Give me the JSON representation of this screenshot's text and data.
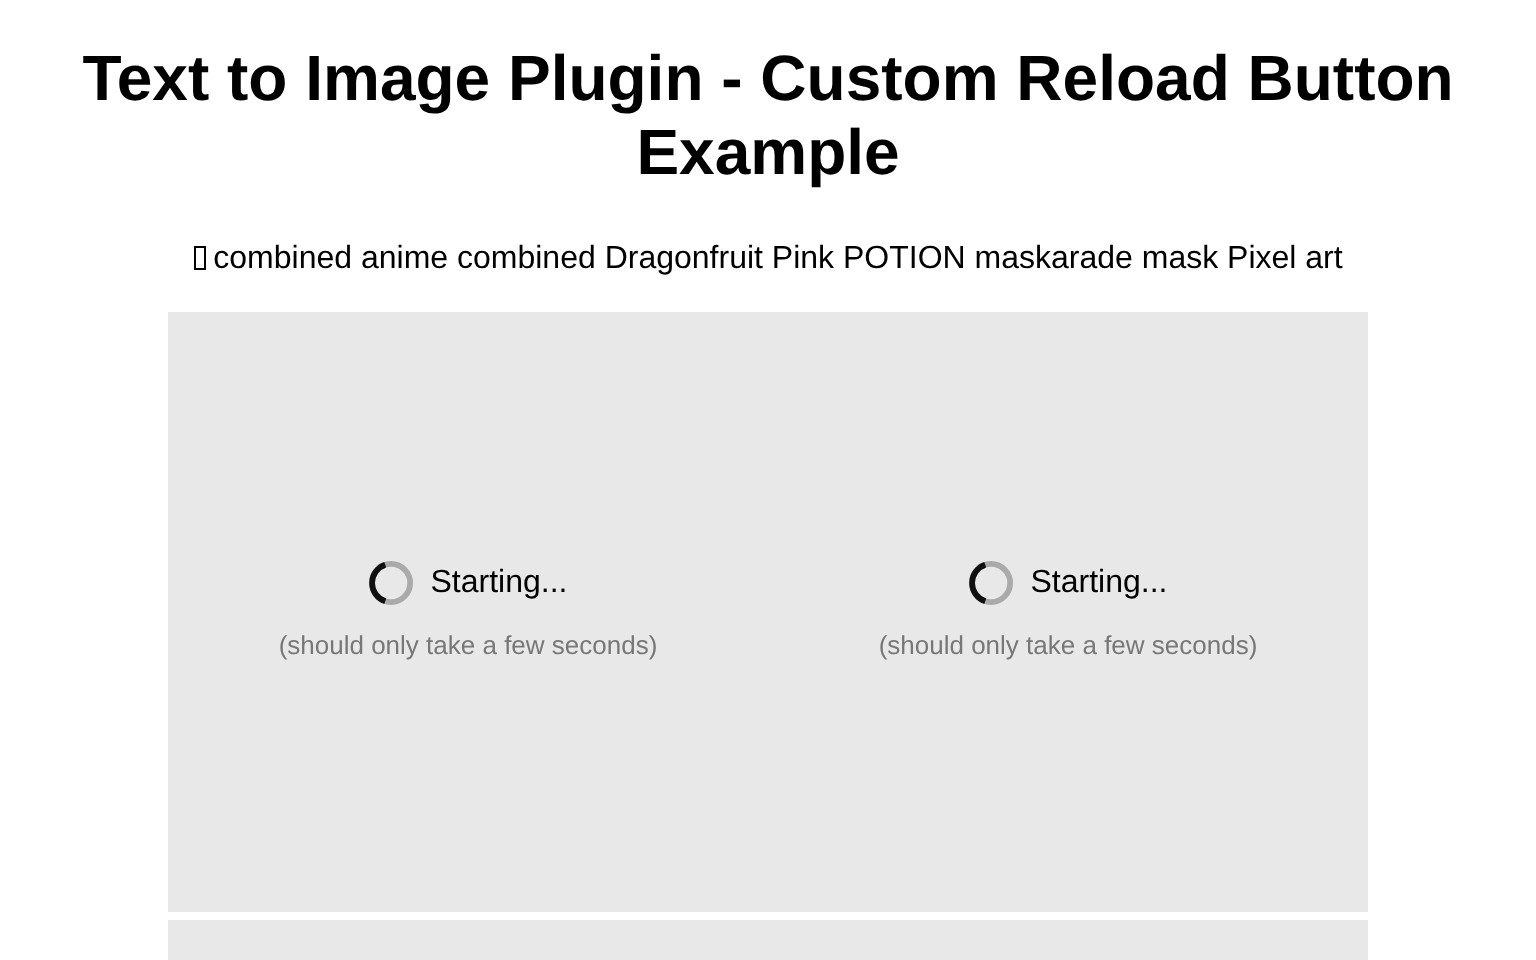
{
  "title": "Text to Image Plugin - Custom Reload Button Example",
  "prompt": "combined anime combined Dragonfruit Pink POTION maskarade mask Pixel art",
  "tiles": [
    {
      "status": "Starting...",
      "note": "(should only take a few seconds)"
    },
    {
      "status": "Starting...",
      "note": "(should only take a few seconds)"
    }
  ]
}
